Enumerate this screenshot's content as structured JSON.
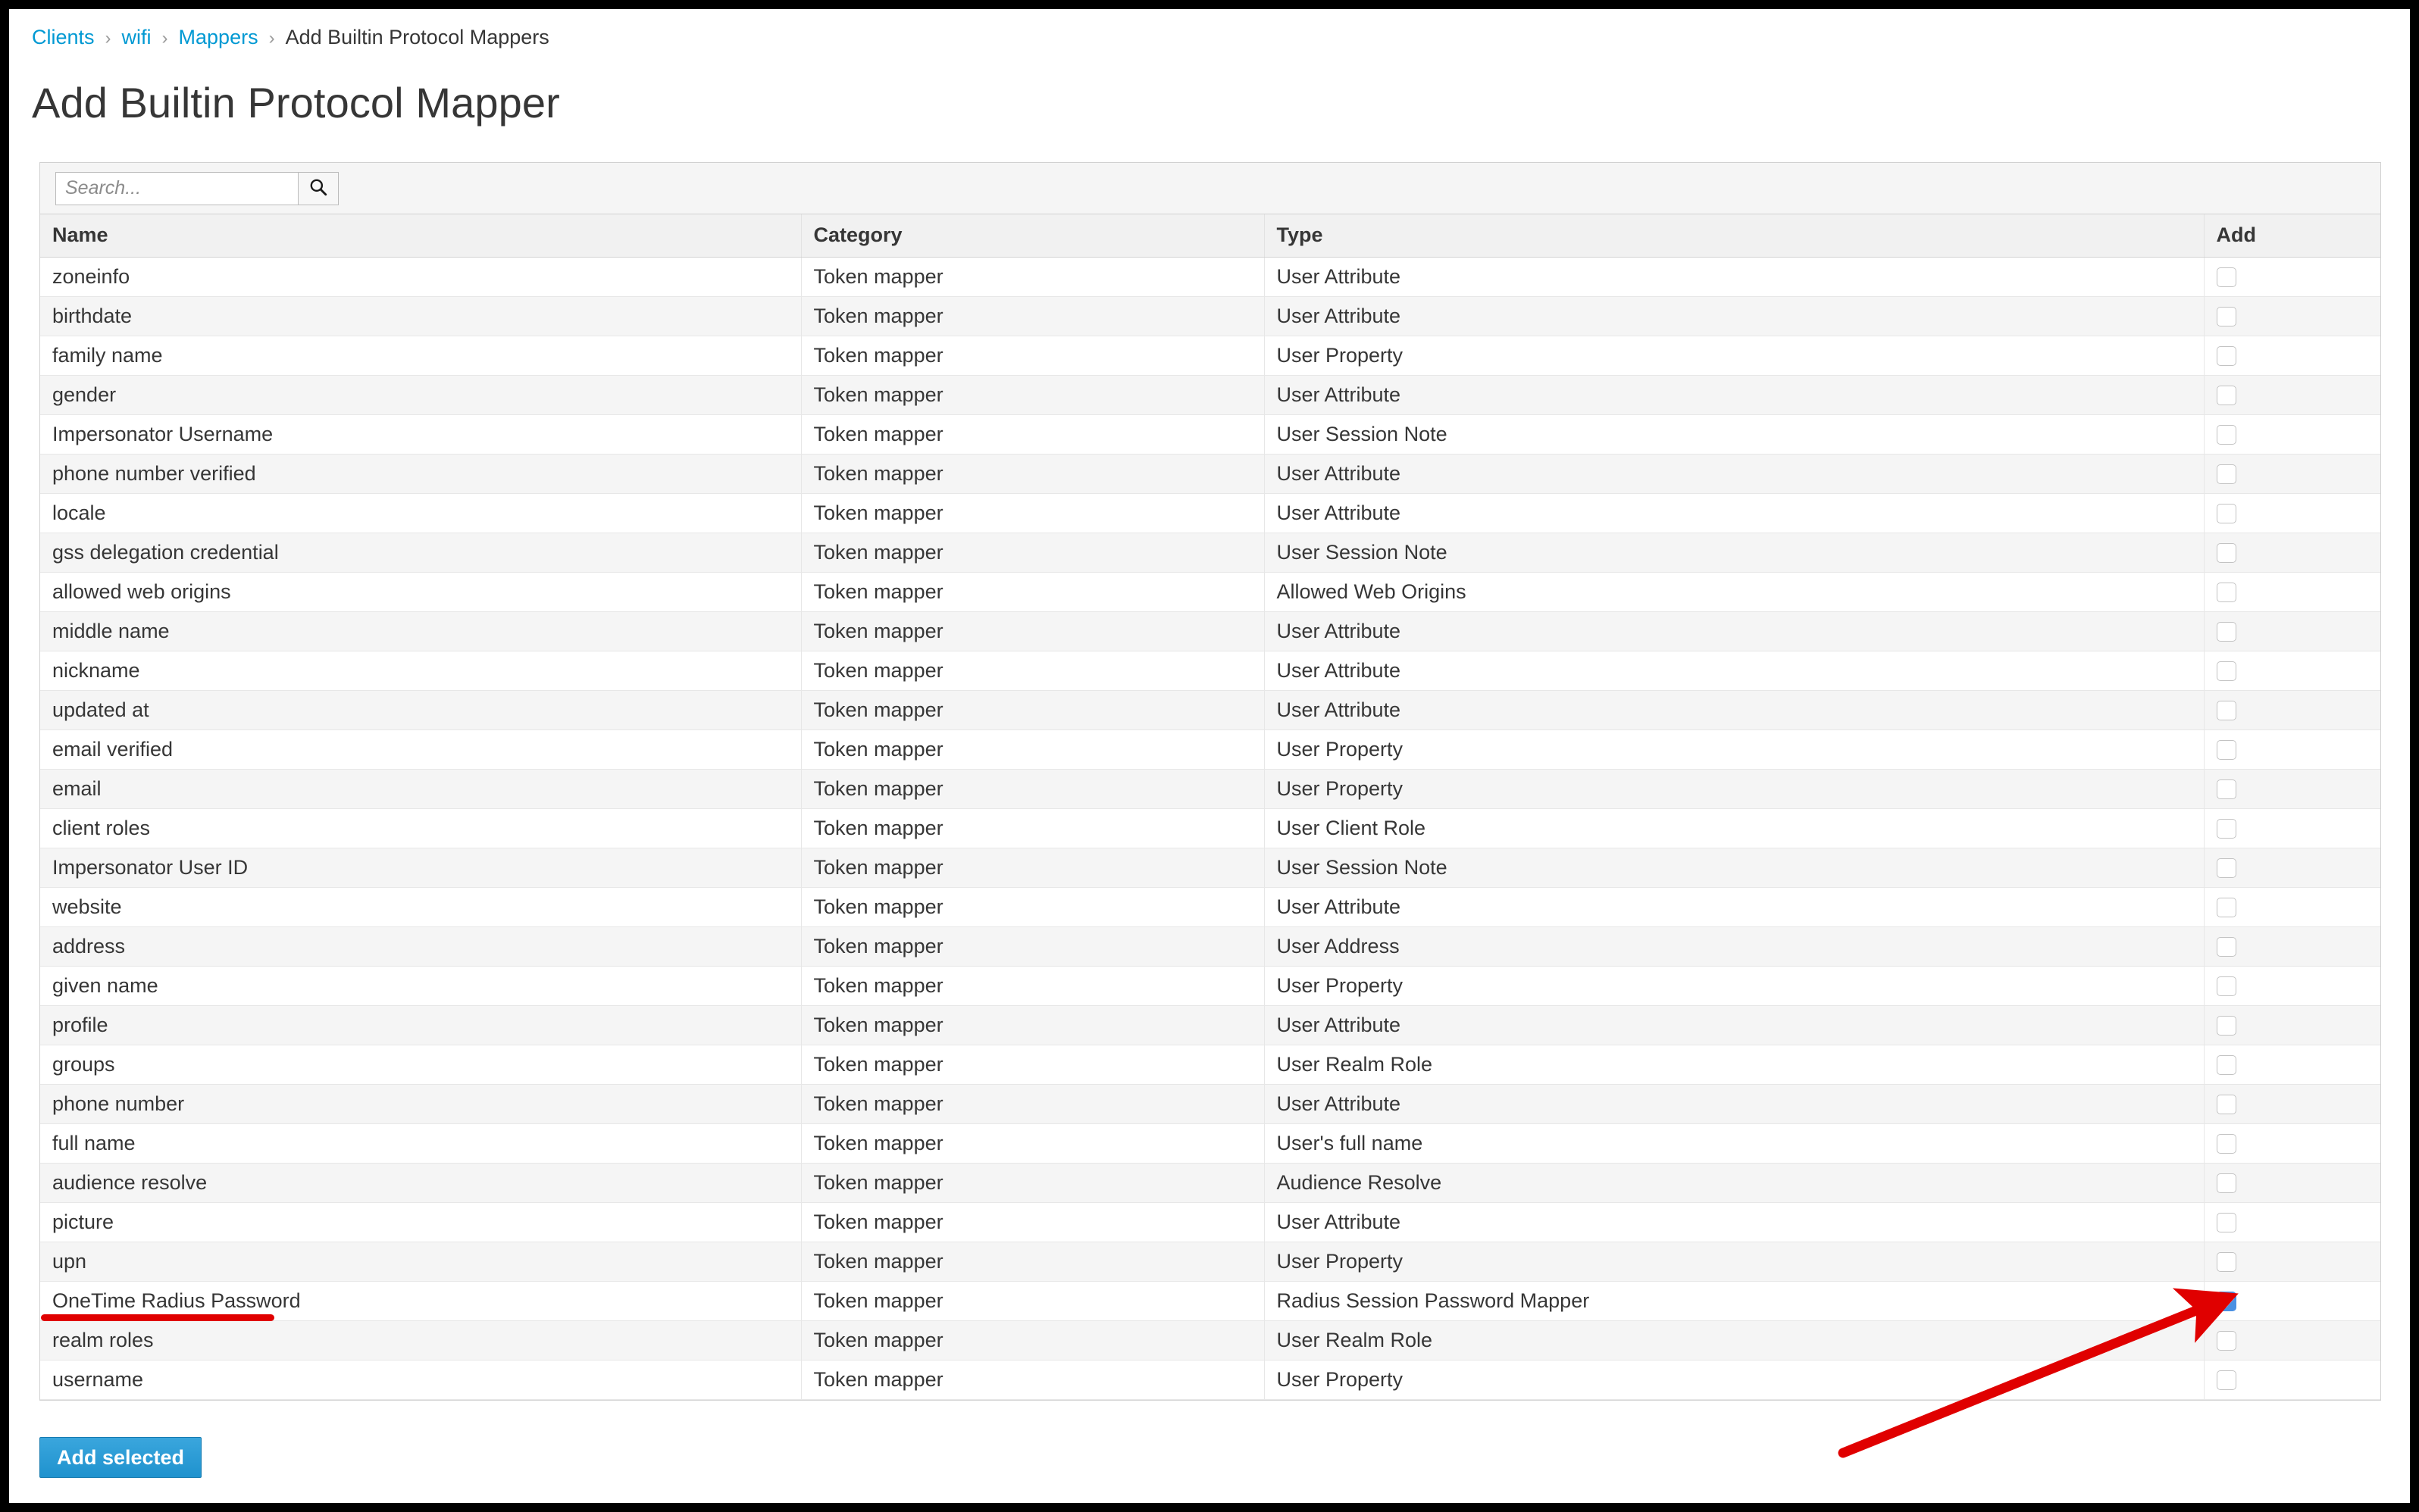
{
  "breadcrumb": {
    "items": [
      {
        "label": "Clients",
        "link": true
      },
      {
        "label": "wifi",
        "link": true
      },
      {
        "label": "Mappers",
        "link": true
      },
      {
        "label": "Add Builtin Protocol Mappers",
        "link": false
      }
    ],
    "separator": "›"
  },
  "page": {
    "title": "Add Builtin Protocol Mapper"
  },
  "search": {
    "placeholder": "Search...",
    "value": "",
    "icon": "search-icon"
  },
  "table": {
    "columns": [
      "Name",
      "Category",
      "Type",
      "Add"
    ],
    "rows": [
      {
        "name": "zoneinfo",
        "category": "Token mapper",
        "type": "User Attribute",
        "checked": false
      },
      {
        "name": "birthdate",
        "category": "Token mapper",
        "type": "User Attribute",
        "checked": false
      },
      {
        "name": "family name",
        "category": "Token mapper",
        "type": "User Property",
        "checked": false
      },
      {
        "name": "gender",
        "category": "Token mapper",
        "type": "User Attribute",
        "checked": false
      },
      {
        "name": "Impersonator Username",
        "category": "Token mapper",
        "type": "User Session Note",
        "checked": false
      },
      {
        "name": "phone number verified",
        "category": "Token mapper",
        "type": "User Attribute",
        "checked": false
      },
      {
        "name": "locale",
        "category": "Token mapper",
        "type": "User Attribute",
        "checked": false
      },
      {
        "name": "gss delegation credential",
        "category": "Token mapper",
        "type": "User Session Note",
        "checked": false
      },
      {
        "name": "allowed web origins",
        "category": "Token mapper",
        "type": "Allowed Web Origins",
        "checked": false
      },
      {
        "name": "middle name",
        "category": "Token mapper",
        "type": "User Attribute",
        "checked": false
      },
      {
        "name": "nickname",
        "category": "Token mapper",
        "type": "User Attribute",
        "checked": false
      },
      {
        "name": "updated at",
        "category": "Token mapper",
        "type": "User Attribute",
        "checked": false
      },
      {
        "name": "email verified",
        "category": "Token mapper",
        "type": "User Property",
        "checked": false
      },
      {
        "name": "email",
        "category": "Token mapper",
        "type": "User Property",
        "checked": false
      },
      {
        "name": "client roles",
        "category": "Token mapper",
        "type": "User Client Role",
        "checked": false
      },
      {
        "name": "Impersonator User ID",
        "category": "Token mapper",
        "type": "User Session Note",
        "checked": false
      },
      {
        "name": "website",
        "category": "Token mapper",
        "type": "User Attribute",
        "checked": false
      },
      {
        "name": "address",
        "category": "Token mapper",
        "type": "User Address",
        "checked": false
      },
      {
        "name": "given name",
        "category": "Token mapper",
        "type": "User Property",
        "checked": false
      },
      {
        "name": "profile",
        "category": "Token mapper",
        "type": "User Attribute",
        "checked": false
      },
      {
        "name": "groups",
        "category": "Token mapper",
        "type": "User Realm Role",
        "checked": false
      },
      {
        "name": "phone number",
        "category": "Token mapper",
        "type": "User Attribute",
        "checked": false
      },
      {
        "name": "full name",
        "category": "Token mapper",
        "type": "User's full name",
        "checked": false
      },
      {
        "name": "audience resolve",
        "category": "Token mapper",
        "type": "Audience Resolve",
        "checked": false
      },
      {
        "name": "picture",
        "category": "Token mapper",
        "type": "User Attribute",
        "checked": false
      },
      {
        "name": "upn",
        "category": "Token mapper",
        "type": "User Property",
        "checked": false
      },
      {
        "name": "OneTime Radius Password",
        "category": "Token mapper",
        "type": "Radius Session Password Mapper",
        "checked": true
      },
      {
        "name": "realm roles",
        "category": "Token mapper",
        "type": "User Realm Role",
        "checked": false
      },
      {
        "name": "username",
        "category": "Token mapper",
        "type": "User Property",
        "checked": false
      }
    ]
  },
  "actions": {
    "add_selected_label": "Add selected"
  },
  "annotations": {
    "underline_color": "#e00000",
    "arrow_color": "#e00000",
    "underline_target": "OneTime Radius Password",
    "arrow_target": "OneTime Radius Password add checkbox"
  },
  "colors": {
    "link": "#0099d3",
    "primary_button": "#1f92ce",
    "checkbox_checked": "#4a90e2",
    "zebra_row": "#f5f5f5",
    "header_row": "#f1f1f1"
  }
}
